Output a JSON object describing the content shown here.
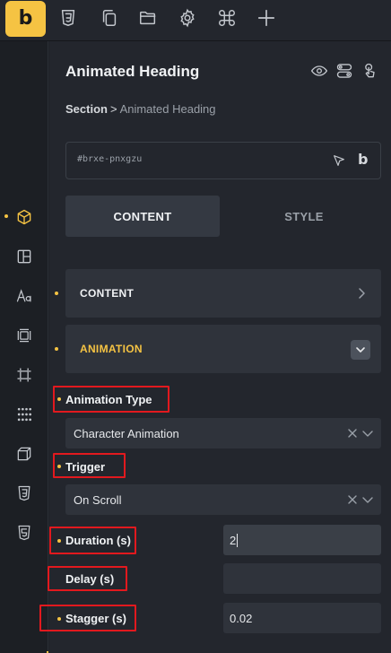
{
  "topbar": {
    "logo": "b",
    "icons": [
      "css3-icon",
      "copy-icon",
      "folder-icon",
      "settings-gear-icon",
      "command-icon",
      "plus-icon"
    ]
  },
  "sidebar": {
    "icons": [
      "cube-icon",
      "layout-icon",
      "typography-icon",
      "spacing-icon",
      "frame-icon",
      "grid-dots-icon",
      "box-3d-icon",
      "css3-icon",
      "html5-icon"
    ],
    "active_index": 0
  },
  "panel": {
    "element_title": "Animated Heading",
    "breadcrumb_parent": "Section",
    "breadcrumb_separator": ">",
    "breadcrumb_current": "Animated Heading",
    "element_id": "#brxe-pnxgzu",
    "id_logo": "b"
  },
  "tabs": {
    "content": "CONTENT",
    "style": "STYLE"
  },
  "accordions": {
    "content_label": "CONTENT",
    "animation_label": "ANIMATION"
  },
  "controls": {
    "animation_type_label": "Animation Type",
    "animation_type_value": "Character Animation",
    "trigger_label": "Trigger",
    "trigger_value": "On Scroll",
    "duration_label": "Duration (s)",
    "duration_value": "2",
    "delay_label": "Delay (s)",
    "delay_value": "",
    "stagger_label": "Stagger (s)",
    "stagger_value": "0.02"
  },
  "colors": {
    "accent": "#f5c343",
    "highlight": "#e2191e",
    "panel_bg": "#23262d"
  }
}
